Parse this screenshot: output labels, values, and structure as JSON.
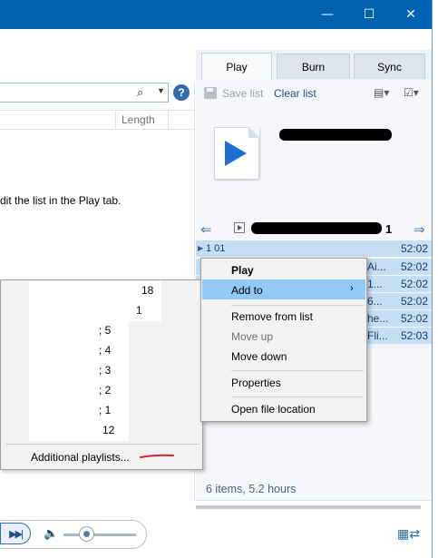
{
  "tabs": [
    {
      "label": "Play"
    },
    {
      "label": "Burn"
    },
    {
      "label": "Sync"
    }
  ],
  "window_controls": {
    "minimize": "—",
    "maximize": "☐",
    "close": "✕"
  },
  "library": {
    "column_length": "Length",
    "hint_text": "dit the list in the Play tab."
  },
  "list_pane": {
    "save_list": "Save list",
    "clear_list": "Clear list",
    "playlist_count": "1",
    "first_row_number": "1 01",
    "rows": [
      {
        "time": "52:02",
        "fragment": ""
      },
      {
        "time": "52:02",
        "fragment": "Ai..."
      },
      {
        "time": "52:02",
        "fragment": "1..."
      },
      {
        "time": "52:02",
        "fragment": "6..."
      },
      {
        "time": "52:02",
        "fragment": "he..."
      },
      {
        "time": "52:03",
        "fragment": "Fli..."
      }
    ],
    "status": "6 items, 5.2 hours"
  },
  "context_menu": {
    "play": "Play",
    "add_to": "Add to",
    "remove_from_list": "Remove from list",
    "move_up": "Move up",
    "move_down": "Move down",
    "properties": "Properties",
    "open_file_location": "Open file location"
  },
  "playlist_submenu": {
    "items": [
      "18",
      "1",
      "; 5",
      "; 4",
      "; 3",
      "; 2",
      "; 1",
      "12"
    ],
    "additional": "Additional playlists..."
  },
  "colors": {
    "titlebar": "#0063b1",
    "selection": "#c5def4",
    "menu_highlight": "#91c9f7",
    "annotation_red": "#d2232a"
  }
}
